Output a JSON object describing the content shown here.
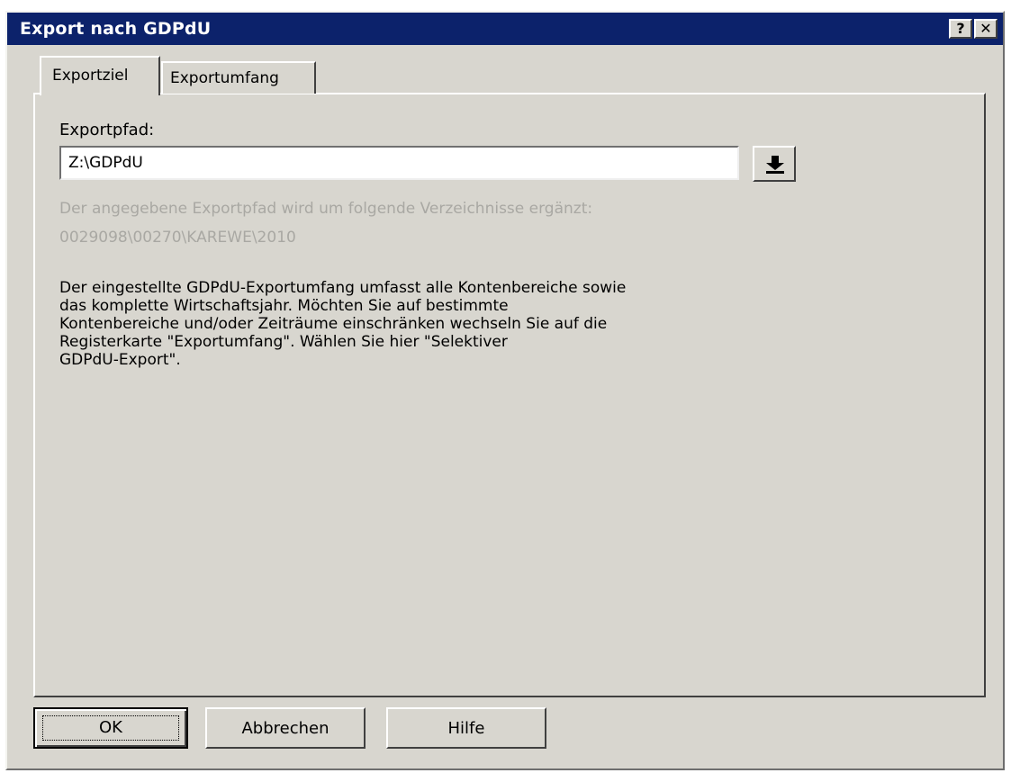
{
  "window": {
    "title": "Export nach GDPdU",
    "help_label": "?",
    "close_label": "✕"
  },
  "tabs": [
    {
      "label": "Exportziel",
      "active": true
    },
    {
      "label": "Exportumfang",
      "active": false
    }
  ],
  "export_path": {
    "label": "Exportpfad:",
    "value": "Z:\\GDPdU",
    "browse_icon": "download-arrow-icon"
  },
  "hint": {
    "line1": "Der angegebene Exportpfad wird um folgende Verzeichnisse ergänzt:",
    "line2": "0029098\\00270\\KAREWE\\2010"
  },
  "info_text": "Der eingestellte GDPdU-Exportumfang umfasst alle Kontenbereiche sowie\ndas komplette Wirtschaftsjahr. Möchten Sie auf bestimmte\nKontenbereiche und/oder Zeiträume einschränken wechseln Sie auf die\nRegisterkarte \"Exportumfang\". Wählen Sie hier \"Selektiver\nGDPdU-Export\".",
  "buttons": {
    "ok": "OK",
    "cancel": "Abbrechen",
    "help": "Hilfe"
  },
  "colors": {
    "titlebar": "#0c226b",
    "dialog_bg": "#d8d6cf",
    "hint_text": "#a9a8a3"
  }
}
